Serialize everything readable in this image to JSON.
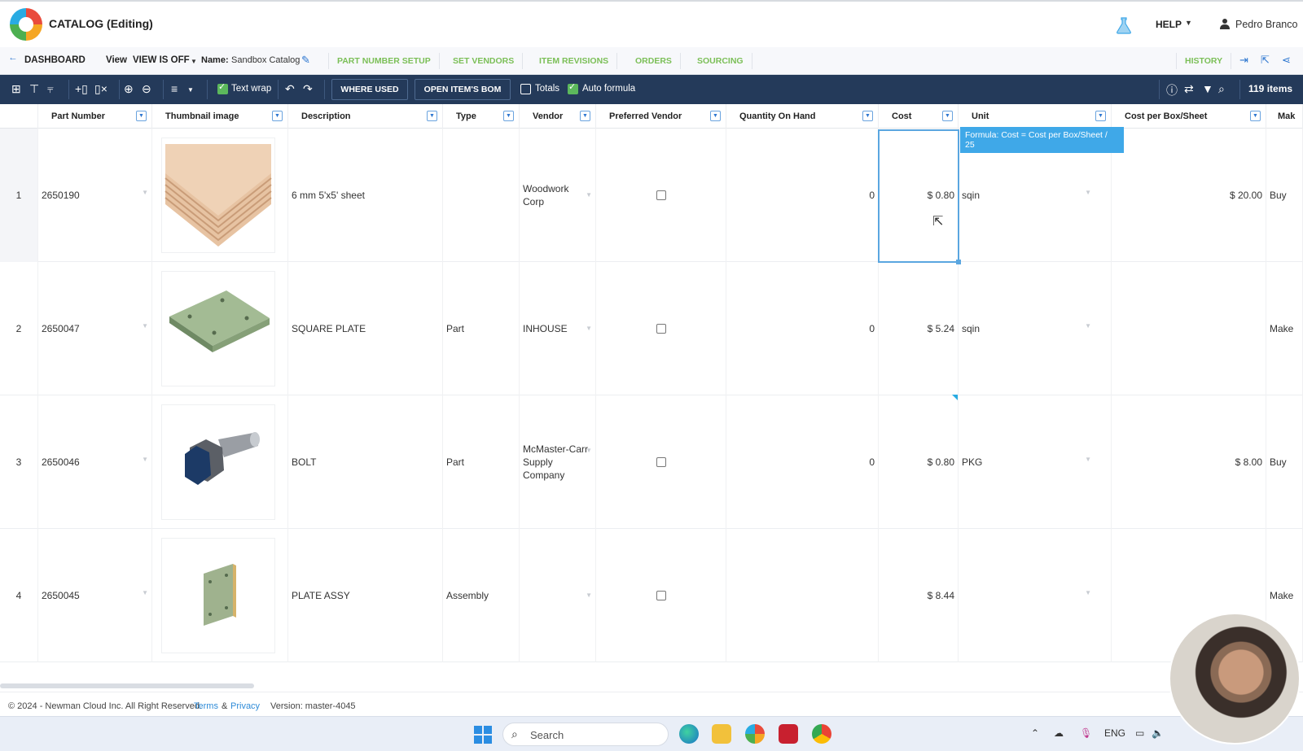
{
  "header": {
    "title": "CATALOG (Editing)",
    "help_label": "HELP",
    "user_name": "Pedro Branco"
  },
  "subnav": {
    "dashboard_label": "DASHBOARD",
    "view_label": "View",
    "view_value": "VIEW IS OFF",
    "name_label": "Name:",
    "name_value": "Sandbox Catalog",
    "tabs": [
      "PART NUMBER SETUP",
      "SET VENDORS",
      "ITEM REVISIONS",
      "ORDERS",
      "SOURCING"
    ],
    "history_label": "HISTORY"
  },
  "toolbar": {
    "text_wrap_label": "Text wrap",
    "text_wrap_checked": true,
    "where_used_label": "WHERE USED",
    "open_bom_label": "OPEN ITEM'S BOM",
    "totals_label": "Totals",
    "totals_checked": false,
    "auto_formula_label": "Auto formula",
    "auto_formula_checked": true,
    "items_count": "119 items"
  },
  "grid": {
    "columns": [
      "Part Number",
      "Thumbnail image",
      "Description",
      "Type",
      "Vendor",
      "Preferred Vendor",
      "Quantity On Hand",
      "Cost",
      "Unit",
      "Cost per Box/Sheet",
      "Mak"
    ],
    "formula_tooltip": "Formula: Cost = Cost per Box/Sheet / 25",
    "rows": [
      {
        "index": "1",
        "part_number": "2650190",
        "thumbnail": "plywood-sheets",
        "description": "6 mm 5'x5' sheet",
        "type": "",
        "vendor": "Woodwork Corp",
        "preferred": false,
        "qty": "0",
        "cost": "$ 0.80",
        "unit": "sqin",
        "cost_per_box": "$ 20.00",
        "make_buy": "Buy"
      },
      {
        "index": "2",
        "part_number": "2650047",
        "thumbnail": "square-plate",
        "description": "SQUARE PLATE",
        "type": "Part",
        "vendor": "INHOUSE",
        "preferred": false,
        "qty": "0",
        "cost": "$ 5.24",
        "unit": "sqin",
        "cost_per_box": "",
        "make_buy": "Make"
      },
      {
        "index": "3",
        "part_number": "2650046",
        "thumbnail": "bolt",
        "description": "BOLT",
        "type": "Part",
        "vendor": "McMaster-Carr Supply Company",
        "preferred": false,
        "qty": "0",
        "cost": "$ 0.80",
        "unit": "PKG",
        "cost_per_box": "$ 8.00",
        "make_buy": "Buy"
      },
      {
        "index": "4",
        "part_number": "2650045",
        "thumbnail": "plate-assembly",
        "description": "PLATE ASSY",
        "type": "Assembly",
        "vendor": "",
        "preferred": false,
        "qty": "",
        "cost": "$ 8.44",
        "unit": "",
        "cost_per_box": "",
        "make_buy": "Make"
      }
    ]
  },
  "footer": {
    "copyright": "© 2024 - Newman Cloud Inc. All Right Reserved.",
    "terms_label": "Terms",
    "amp": "&",
    "privacy_label": "Privacy",
    "version": "Version: master-4045"
  },
  "taskbar": {
    "search_placeholder": "Search",
    "lang": "ENG"
  },
  "colors": {
    "toolbar_bg": "#243a5a",
    "tab_green": "#7bbf57",
    "accent_blue": "#2e77d0",
    "tooltip_blue": "#3fa8e8"
  }
}
